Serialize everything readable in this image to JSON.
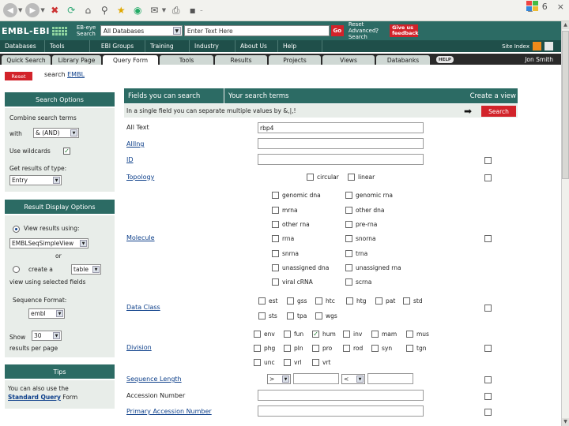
{
  "browser": {
    "window_controls": [
      "_",
      "6",
      "×"
    ]
  },
  "header": {
    "logo": "EMBL-EBI",
    "search_label": "EB-eye Search",
    "db_select": "All Databases",
    "text_placeholder": "Enter Text Here",
    "go": "Go",
    "reset_label": "Reset Advanced Search",
    "feedback": "Give us feedback"
  },
  "nav": {
    "items": [
      "Databases",
      "Tools",
      "EBI Groups",
      "Training",
      "Industry",
      "About Us",
      "Help"
    ],
    "site_index": "Site Index"
  },
  "tabs": {
    "items": [
      "Quick Search",
      "Library Page",
      "Query Form",
      "Tools",
      "Results",
      "Projects",
      "Views",
      "Databanks"
    ],
    "help": "HELP",
    "user": "Jon Smith"
  },
  "crumb": {
    "reset": "Reset",
    "prefix": "search",
    "link": "EMBL"
  },
  "sidebar": {
    "search_options": {
      "title": "Search Options",
      "combine_label": "Combine search terms",
      "with": "with",
      "combine_value": "& (AND)",
      "wildcards": "Use wildcards",
      "results_type_label": "Get results of type:",
      "results_type_value": "Entry"
    },
    "display": {
      "title": "Result Display Options",
      "view_using": "View results using:",
      "view_value": "EMBLSeqSimpleView",
      "or": "or",
      "create_a": "create a",
      "table": "table",
      "view_selected": "view using selected fields",
      "seq_format": "Sequence Format:",
      "seq_value": "embl",
      "show": "Show",
      "show_value": "30",
      "per_page": "results per page"
    },
    "tips": {
      "title": "Tips",
      "text": "You can also use the",
      "link": "Standard Query",
      "after": "Form"
    }
  },
  "form": {
    "head": {
      "fields": "Fields you can search",
      "terms": "Your search terms",
      "create": "Create a view"
    },
    "hint": "In a single field you can separate multiple values by &,|,!",
    "search_btn": "Search",
    "rows": {
      "all_text": "All Text",
      "all_text_value": "rbp4",
      "all_ing": "AllIng",
      "id": "ID",
      "topology": "Topology",
      "molecule": "Molecule",
      "data_class": "Data Class",
      "division": "Division",
      "sequence_length": "Sequence Length",
      "accession": "Accession Number",
      "primary_accession": "Primary Accession Number"
    },
    "topology_opts": [
      "circular",
      "linear"
    ],
    "molecule_opts": [
      "genomic dna",
      "genomic rna",
      "mrna",
      "other dna",
      "other rna",
      "pre-rna",
      "rrna",
      "snorna",
      "snrna",
      "trna",
      "unassigned dna",
      "unassigned rna",
      "viral cRNA",
      "scrna"
    ],
    "dataclass_opts": [
      "est",
      "gss",
      "htc",
      "htg",
      "pat",
      "std",
      "sts",
      "tpa",
      "wgs"
    ],
    "division_opts": [
      "env",
      "fun",
      "hum",
      "inv",
      "mam",
      "mus",
      "phg",
      "pln",
      "pro",
      "rod",
      "syn",
      "tgn",
      "unc",
      "vrl",
      "vrt"
    ],
    "division_checked": "hum",
    "length_op": ">",
    "length_op2": "<"
  }
}
